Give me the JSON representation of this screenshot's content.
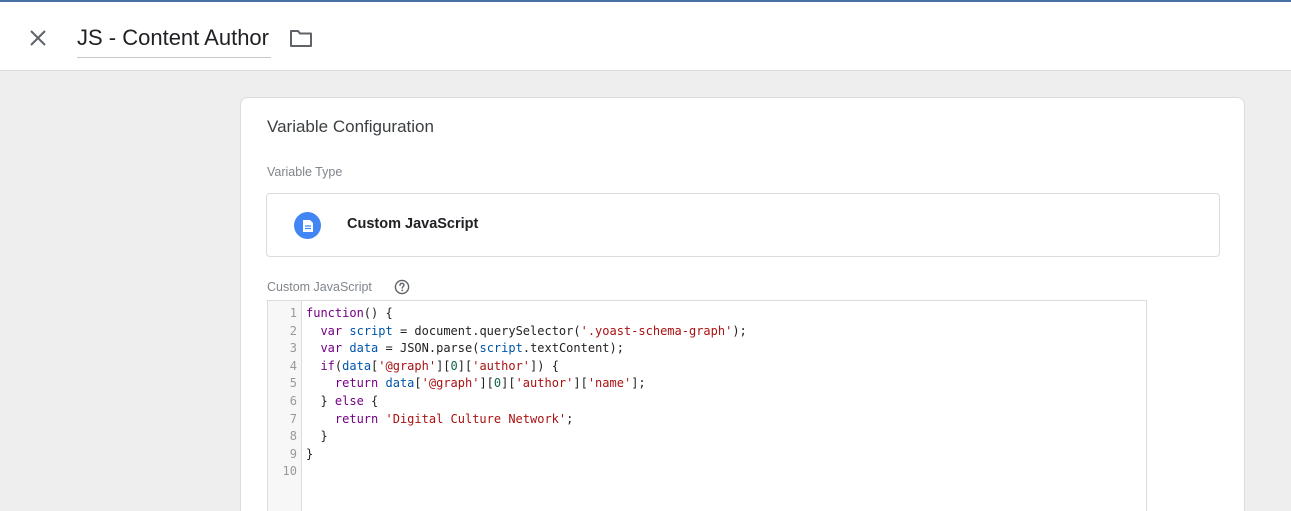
{
  "header": {
    "title": "JS - Content Author",
    "close_icon": "close-icon",
    "folder_icon": "folder-icon"
  },
  "card": {
    "title": "Variable Configuration",
    "type_label": "Variable Type",
    "type_name": "Custom JavaScript",
    "type_icon": "document-icon",
    "code_label": "Custom JavaScript",
    "help_icon": "help-circle-icon"
  },
  "colors": {
    "accent": "#4285f4",
    "keyword": "#770088",
    "variable": "#0055aa",
    "string": "#aa1111",
    "number": "#116644"
  },
  "editor": {
    "line_numbers": [
      "1",
      "2",
      "3",
      "4",
      "5",
      "6",
      "7",
      "8",
      "9",
      "10"
    ],
    "lines": [
      "function() {",
      "  var script = document.querySelector('.yoast-schema-graph');",
      "  var data = JSON.parse(script.textContent);",
      "  if(data['@graph'][0]['author']) {",
      "    return data['@graph'][0]['author']['name'];",
      "  } else {",
      "    return 'Digital Culture Network';",
      "  }",
      "}",
      ""
    ]
  }
}
